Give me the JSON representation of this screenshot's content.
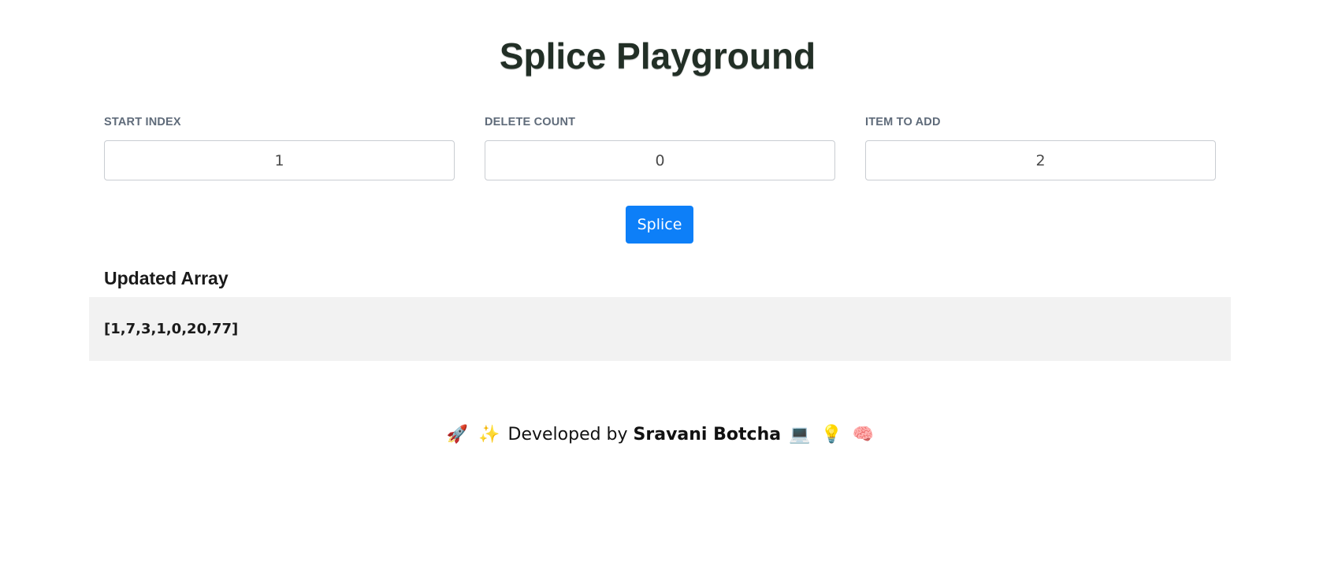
{
  "title": "Splice Playground",
  "fields": [
    {
      "label": "START INDEX",
      "value": "1"
    },
    {
      "label": "DELETE COUNT",
      "value": "0"
    },
    {
      "label": "ITEM TO ADD",
      "value": "2"
    }
  ],
  "action": {
    "splice_label": "Splice"
  },
  "result": {
    "heading": "Updated Array",
    "value": "[1,7,3,1,0,20,77]"
  },
  "footer": {
    "emoji_left_1": "🚀",
    "emoji_left_2": "✨",
    "prefix": "Developed by",
    "author": "Sravani Botcha",
    "emoji_right_1": "💻",
    "emoji_right_2": "💡",
    "emoji_right_3": "🧠",
    "icons": [
      "rocket-icon",
      "sparkles-icon",
      "laptop-icon",
      "lightbulb-icon",
      "brain-icon"
    ]
  },
  "colors": {
    "primary_button": "#0d7ff8",
    "result_background": "#f2f2f2",
    "label_text": "#5f6b7a",
    "title_text": "#222f26"
  }
}
